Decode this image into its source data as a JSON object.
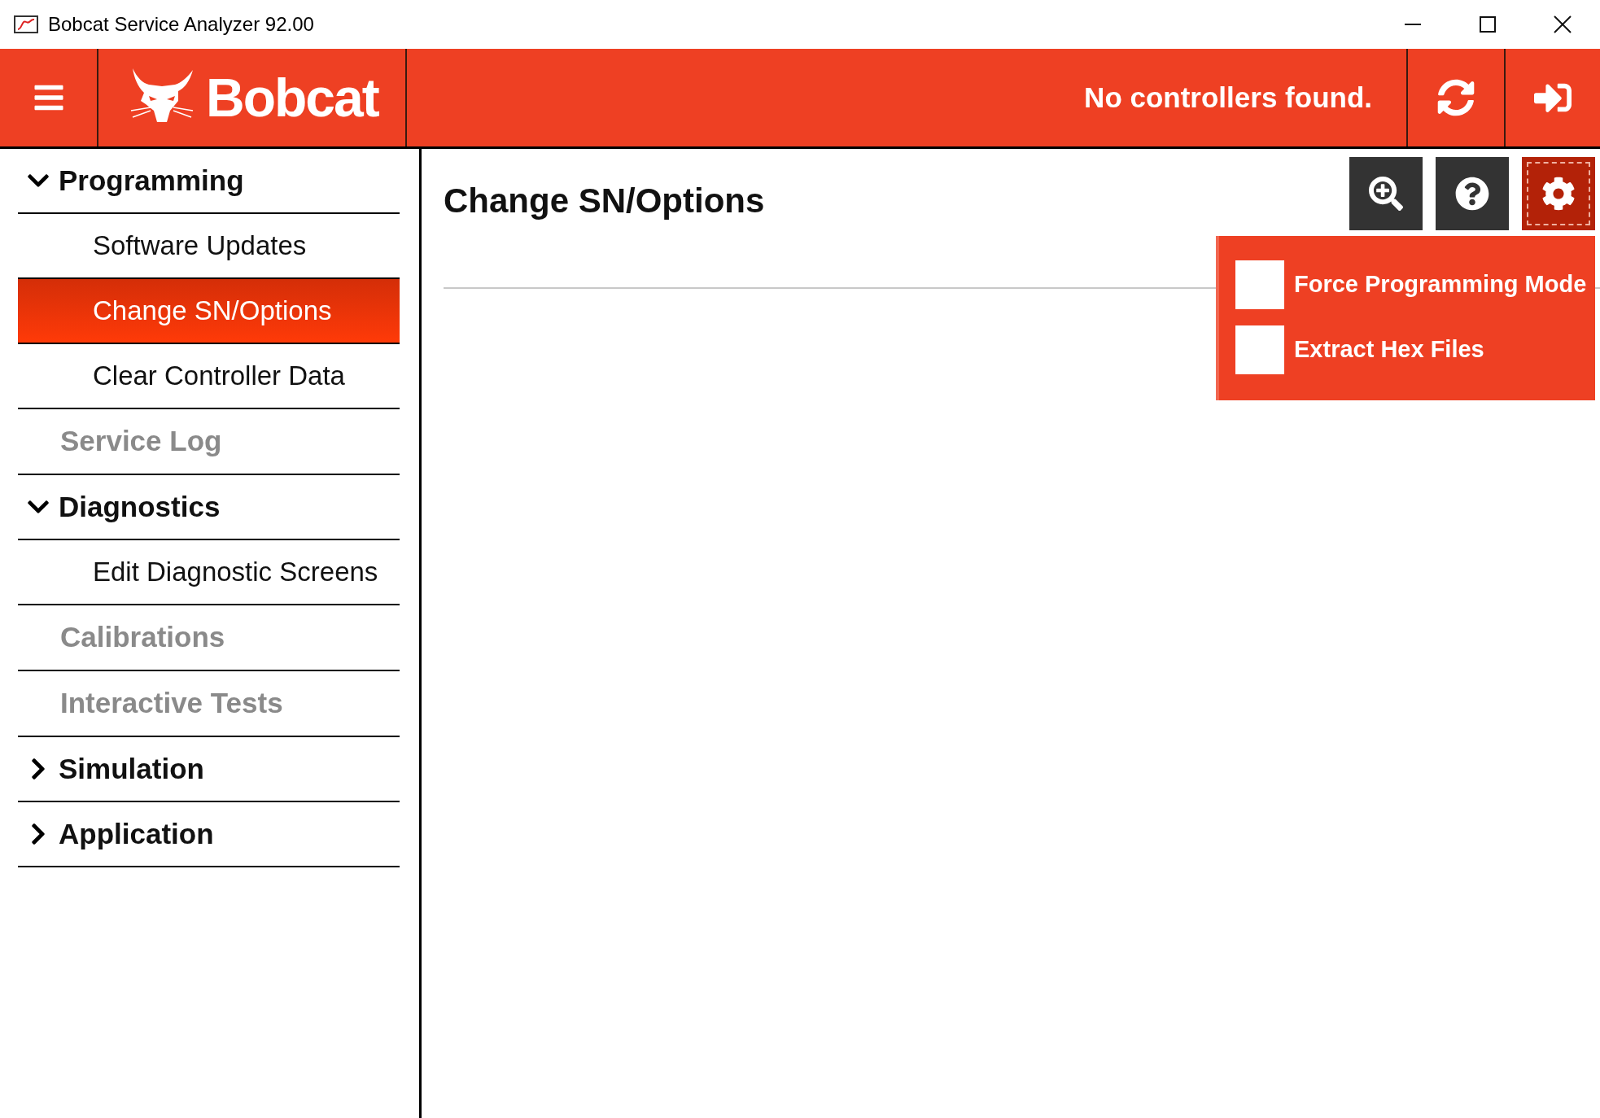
{
  "window": {
    "title": "Bobcat Service Analyzer 92.00"
  },
  "header": {
    "logo_text": "Bobcat",
    "status": "No controllers found."
  },
  "sidebar": {
    "items": [
      {
        "kind": "group",
        "label": "Programming",
        "expanded": true,
        "children": [
          {
            "label": "Software Updates",
            "selected": false
          },
          {
            "label": "Change SN/Options",
            "selected": true
          },
          {
            "label": "Clear Controller Data",
            "selected": false
          }
        ]
      },
      {
        "kind": "link",
        "label": "Service Log",
        "disabled": true
      },
      {
        "kind": "group",
        "label": "Diagnostics",
        "expanded": true,
        "children": [
          {
            "label": "Edit Diagnostic Screens",
            "selected": false
          }
        ]
      },
      {
        "kind": "link",
        "label": "Calibrations",
        "disabled": true
      },
      {
        "kind": "link",
        "label": "Interactive Tests",
        "disabled": true
      },
      {
        "kind": "group",
        "label": "Simulation",
        "expanded": false
      },
      {
        "kind": "group",
        "label": "Application",
        "expanded": false
      }
    ]
  },
  "content": {
    "title": "Change SN/Options",
    "tools": [
      {
        "kind": "zoom",
        "active": false
      },
      {
        "kind": "help",
        "active": false
      },
      {
        "kind": "settings",
        "active": true
      }
    ],
    "menu": [
      {
        "label": "Force Programming Mode",
        "checked": false
      },
      {
        "label": "Extract Hex Files",
        "checked": false
      }
    ]
  }
}
